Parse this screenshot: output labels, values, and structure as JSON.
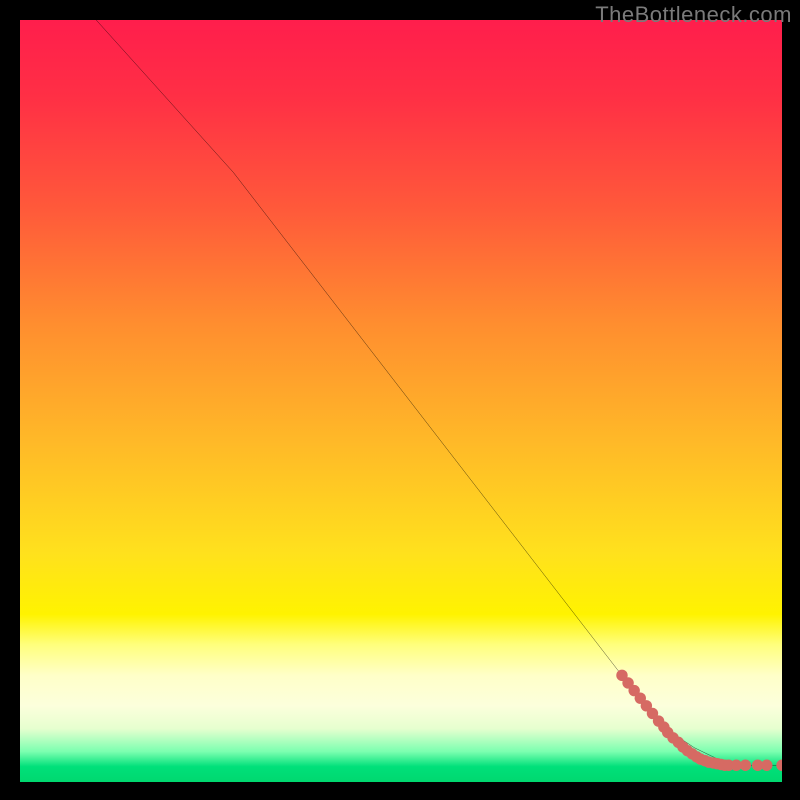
{
  "attribution": "TheBottleneck.com",
  "chart_data": {
    "type": "line",
    "title": "",
    "xlabel": "",
    "ylabel": "",
    "xlim": [
      0,
      100
    ],
    "ylim": [
      0,
      100
    ],
    "grid": false,
    "legend": false,
    "series": [
      {
        "name": "curve",
        "render": "line",
        "color": "#000000",
        "x": [
          10,
          28,
          84,
          88.5,
          92,
          95,
          100
        ],
        "y": [
          100,
          80,
          7.5,
          4.5,
          2.8,
          2.2,
          2.2
        ]
      },
      {
        "name": "points",
        "render": "scatter",
        "color": "#d66a63",
        "x": [
          79.0,
          79.8,
          80.6,
          81.4,
          82.2,
          83.0,
          83.8,
          84.5,
          85.0,
          85.7,
          86.4,
          87.0,
          87.6,
          88.2,
          88.8,
          89.3,
          89.9,
          90.4,
          91.0,
          91.5,
          92.0,
          92.5,
          93.0,
          94.0,
          95.2,
          96.8,
          98.0,
          100.0
        ],
        "y": [
          14.0,
          13.0,
          12.0,
          11.0,
          10.0,
          9.0,
          8.0,
          7.2,
          6.5,
          5.8,
          5.2,
          4.6,
          4.1,
          3.7,
          3.3,
          3.0,
          2.8,
          2.6,
          2.5,
          2.4,
          2.3,
          2.2,
          2.2,
          2.2,
          2.2,
          2.2,
          2.2,
          2.2
        ]
      }
    ],
    "background_gradient": {
      "direction": "vertical",
      "stops": [
        {
          "pos": 0.0,
          "color": "#ff1e4c"
        },
        {
          "pos": 0.55,
          "color": "#ffe11d"
        },
        {
          "pos": 0.86,
          "color": "#ffffc8"
        },
        {
          "pos": 0.96,
          "color": "#7cffb0"
        },
        {
          "pos": 1.0,
          "color": "#00d86f"
        }
      ]
    }
  }
}
